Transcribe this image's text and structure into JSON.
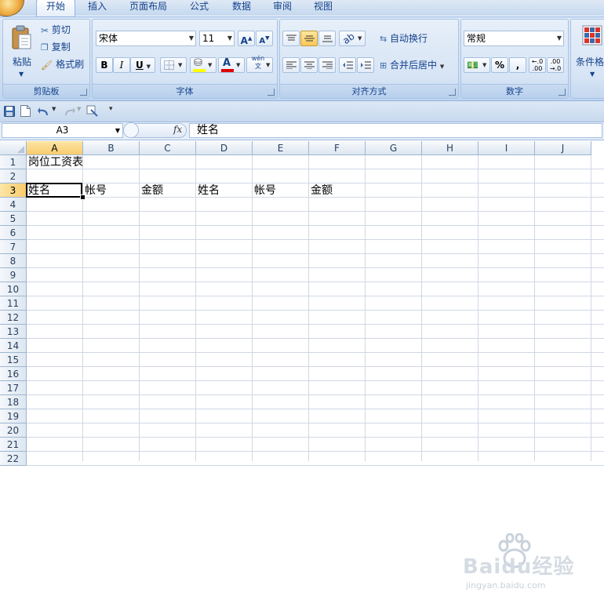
{
  "ribbon_tabs": [
    "开始",
    "插入",
    "页面布局",
    "公式",
    "数据",
    "审阅",
    "视图"
  ],
  "groups": {
    "clipboard": {
      "label": "剪贴板",
      "paste": "粘贴",
      "cut": "剪切",
      "copy": "复制",
      "format_painter": "格式刷"
    },
    "font": {
      "label": "字体",
      "font_name": "宋体",
      "font_size": "11",
      "bold": "B",
      "italic": "I",
      "underline": "U",
      "font_color": "A",
      "phonetic": "wén 文"
    },
    "alignment": {
      "label": "对齐方式",
      "wrap_text": "自动换行",
      "merge_center": "合并后居中"
    },
    "number": {
      "label": "数字",
      "format": "常规",
      "percent": "%",
      "comma": ","
    },
    "styles": {
      "conditional": "条件格"
    }
  },
  "formula_bar": {
    "name_box": "A3",
    "fx": "fx",
    "content": "姓名"
  },
  "columns": [
    "A",
    "B",
    "C",
    "D",
    "E",
    "F",
    "G",
    "H",
    "I",
    "J"
  ],
  "rows": [
    "1",
    "2",
    "3",
    "4",
    "5",
    "6",
    "7",
    "8",
    "9",
    "10",
    "11",
    "12",
    "13",
    "14",
    "15",
    "16",
    "17",
    "18",
    "19",
    "20",
    "21",
    "22"
  ],
  "cells": {
    "A1": "岗位工资表",
    "A3": "姓名",
    "B3": "帐号",
    "C3": "金额",
    "D3": "姓名",
    "E3": "帐号",
    "F3": "金额"
  },
  "active_cell": "A3",
  "watermark": {
    "brand": "Baidu经验",
    "url": "jingyan.baidu.com"
  },
  "colors": {
    "ribbon_text": "#15428b",
    "selected_button": "#fbc757",
    "grid_line": "#d0d7e5",
    "header_highlight": "#f8cb6c"
  }
}
